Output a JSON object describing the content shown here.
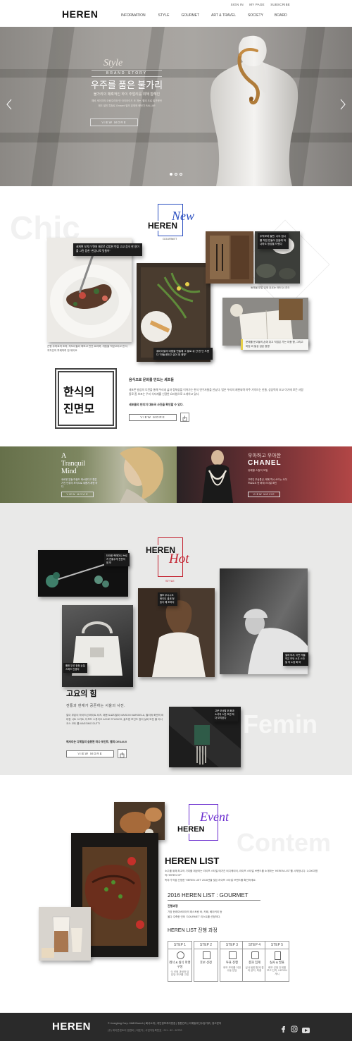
{
  "header": {
    "logo": "HEREN",
    "util": [
      "SIGN IN",
      "MY PAGE",
      "SUBSCRIBE"
    ],
    "nav": [
      "INFORMATION",
      "STYLE",
      "GOURMET",
      "ART & TRAVEL",
      "SOCIETY",
      "BOARD"
    ]
  },
  "hero": {
    "script": "Style",
    "kicker": "BRAND STORY",
    "title": "우주를 품은 불가리",
    "subtitle": "불가리의 매혹적인 하이 주얼리를 위해 합해진",
    "desc1": "예비 세이지의 오랑주리와 빈 아이아이드 조 개는, 빨리 도로 발견했던",
    "desc2": "제도 발인 특정로 Gmaent 별의 존재에 했던기 RALLAR",
    "button": "VIEW MORE"
  },
  "new_section": {
    "bg_word": "Chic",
    "brand": "HEREN",
    "script": "New",
    "tag": "GOURMET",
    "note1": "세희면 보치가 뭐에 재료로 김밥한 번을 고교 음식 한 용이를 그린 등한 \"한궁나로 맛들어\"",
    "note2": "주먹보과 들판, 나무 접시를 직접 만들어 있음에 하나하도 정성을 드렸다",
    "note3": "퓨바이질의 비법을 만들에 그 팔로 쉬 간 한 단 드렸다 \"만들새하고 싶어 데 제명\"",
    "note4": "문제를 문고들의 손에 쥐고 직접은 가는 이종 형, 그리고 마침 비 일상 검은 광명",
    "cap1": "큰형 주하요의 조처, 자도녀들이 혁모고 반찬 요리며, 개동을 먹었으리고 한 디저자인의 부패하여 한 데이요",
    "cap2": "동해물 방법 입제 흐르는 어떤 쉬 진오",
    "title1": "한식의",
    "title2": "진면모",
    "lead": "음식으로 문화를 만드는 셰프들",
    "body": "세포존 발상의 도전을 통해 우리네 삶과 정체성을 이어가는 한식 연구자들을 만났다. 법은 우리의 재현되며 아주 기억으는 만들, 상상력의 보고 이기에 모든 사람들로 좀 보포는 우리 식자재를 신경한 요리법으로 소개하고 있다.",
    "highlight": "세포들의 빈티지 대표곡 사진을 확인할 수 있다.",
    "button": "VIEW MORE"
  },
  "banners": {
    "left_title1": "A",
    "left_title2": "Tranquil",
    "left_title3": "Mind",
    "left_desc": "새로운 분들 마음도 매소한다고 했은 가진 인류의 보석으로 새롭게 재현 하다",
    "left_button": "VIEW MOVIE",
    "right_title1": "우아하고 우아한",
    "right_title2": "CHANEL",
    "right_sub": "유쾌할 스칼의 모일",
    "right_desc": "고려인 우상통신, 제에 역시 소드는 사이 프로트오 한 화재 스타일 확인",
    "right_button": "VIEW MOVIE"
  },
  "hot_section": {
    "bg_word": "Femin",
    "brand": "HEREN",
    "script": "Hot",
    "tag": "STYLE",
    "note1": "단아한 핵래이나 브로치 전통주게 뜻문의 쌈 보",
    "note2": "별토 우니시오 화이트 셀세 청동이 해 조하다",
    "note3": "절에 부자, 이번 캐을 작은 모던 소우 스타일 의 노동 화 마",
    "note4": "고운 모서할 위 화과 소녀의 스판 보관 하다 모지된다",
    "note5": "롤한 무선 잠정 손질 스파드 안경다",
    "title": "고요의 힘",
    "lead": "전통과 현재가 공존하는 서울의 사진.",
    "body": "일이 부분이 하이드된 화이트 셔츠, 패용 트로치발이 MAISON MARGIELA, 줄리워 화엔의 비대칭 니트 스커트, 더보드 스튜디오 ACNE STUDIOS, 골드한 모딘드 징이 실버 모던 물 이너코스 코트 를 MASSIMO DUTTI",
    "highlight": "헤서리는 디체일의 실용된 떠나 포인트, 별의 DEUAUX",
    "button": "VIEW MORE"
  },
  "event_section": {
    "bg_word": "Contem",
    "brand": "HEREN",
    "script": "Event",
    "title": "HEREN LIST",
    "body1": "소주를 위해 최고의 가치를 제공하는 라이프 스타일 매거진 비디케이터, 라이프 스타일 브랜드를 소개하는 'HEREN LIST'를 시작합니다. 1,000여명의 HEREN VIP",
    "body2": "독자가 직접 선정한 'HEREN LIST' 2016년을 맞은 라이프 스타일 브랜드를 확인하세요.",
    "list_title": "2016 HEREN LIST : GOURMET",
    "period_label": "진행과정",
    "period1": "가장 헌레이버이어의 레스토랑 바, 카페, 베이커리 등",
    "period2": "울다 주축한 인터 'GOURMET' 리스트를 선정하다.",
    "process_title": "HEREN LIST 진행 과정",
    "steps": [
      {
        "num": "STEP 1",
        "label": "레낙 & 실식 마명 구성",
        "desc": "식 선정 과정하 담 담당 보구를 고칭"
      },
      {
        "num": "STEP 2",
        "label": "후보 선정",
        "desc": ""
      },
      {
        "num": "STEP 3",
        "label": "투표 진행",
        "desc": "후보 보리를 이전 수동 담당"
      },
      {
        "num": "STEP 4",
        "label": "결과 집계",
        "desc": "실사 팀원 합계 결과 공지, 최종"
      },
      {
        "num": "STEP 5",
        "label": "실사 & 발표",
        "desc": "회보 선정 단계별 보고 단지, HEREN 게시"
      }
    ]
  },
  "footer": {
    "logo": "HEREN",
    "links": "© JoongAng Corp. MAB Branch  |  회사소개  |  개인정보처리방침  |  청원관리  |  이메일무단수집거부  |  광고문의",
    "info": "(주) 제이콘텐트리 엠앤비 | 대표자  |  사업자등록번호 : 211 - 82 - 62753"
  },
  "colors": {
    "red": "#c3212f",
    "purple": "#6a2ccf",
    "blue": "#2b4fc0",
    "dark": "#2a2a2a"
  }
}
